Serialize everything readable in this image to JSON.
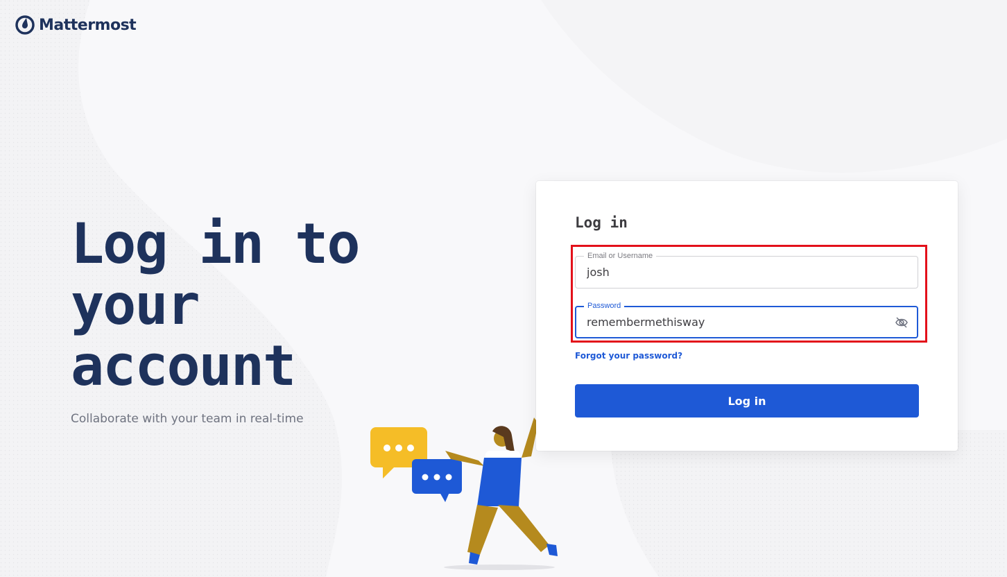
{
  "brand": {
    "name": "Mattermost"
  },
  "hero": {
    "title": "Log in to your account",
    "subtitle": "Collaborate with your team in real-time"
  },
  "login_card": {
    "heading": "Log in",
    "email_field": {
      "label": "Email or Username",
      "value": "josh"
    },
    "password_field": {
      "label": "Password",
      "value": "remembermethisway",
      "toggle_icon": "eye-off-icon"
    },
    "forgot_link": "Forgot your password?",
    "submit_label": "Log in"
  },
  "colors": {
    "brand_navy": "#1e325c",
    "primary_blue": "#1e59d6",
    "highlight_red": "#e3101a",
    "bubble_yellow": "#f5bd27"
  }
}
